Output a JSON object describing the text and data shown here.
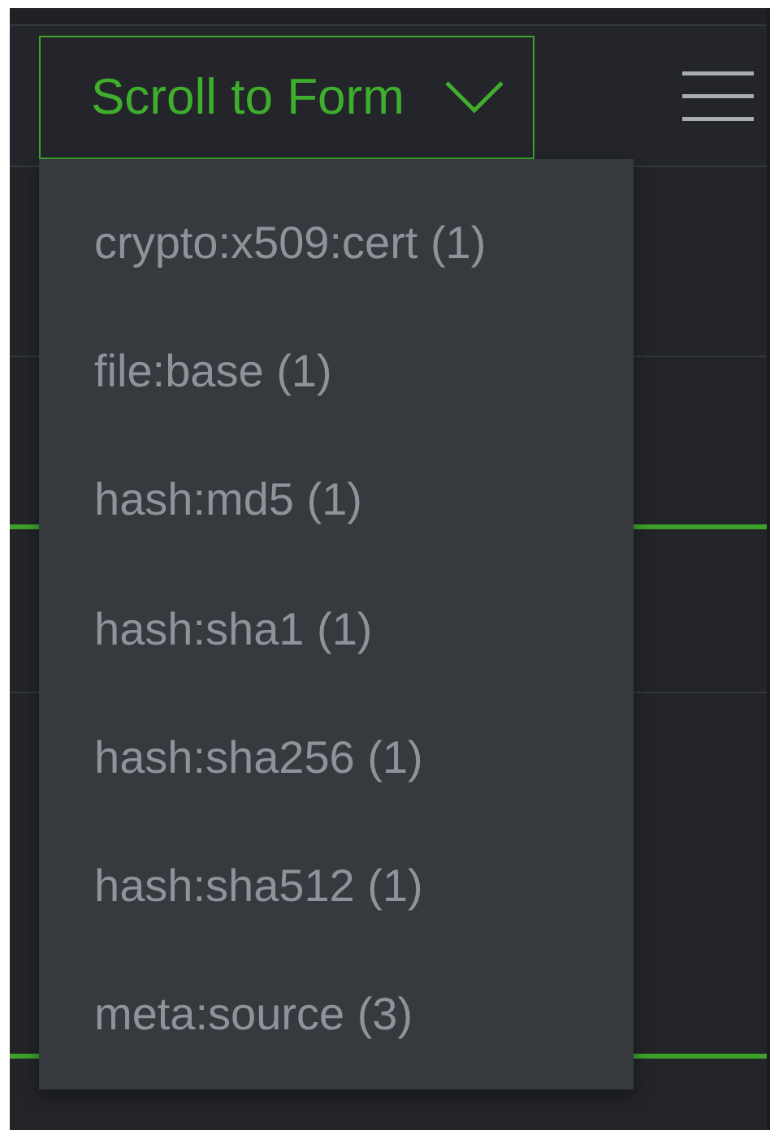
{
  "header": {
    "scroll_button": {
      "label": "Scroll to Form",
      "expanded": true
    }
  },
  "dropdown": {
    "items": [
      {
        "label": "crypto:x509:cert (1)"
      },
      {
        "label": "file:base (1)"
      },
      {
        "label": "hash:md5 (1)"
      },
      {
        "label": "hash:sha1 (1)"
      },
      {
        "label": "hash:sha256 (1)"
      },
      {
        "label": "hash:sha512 (1)"
      },
      {
        "label": "meta:source (3)"
      }
    ]
  }
}
